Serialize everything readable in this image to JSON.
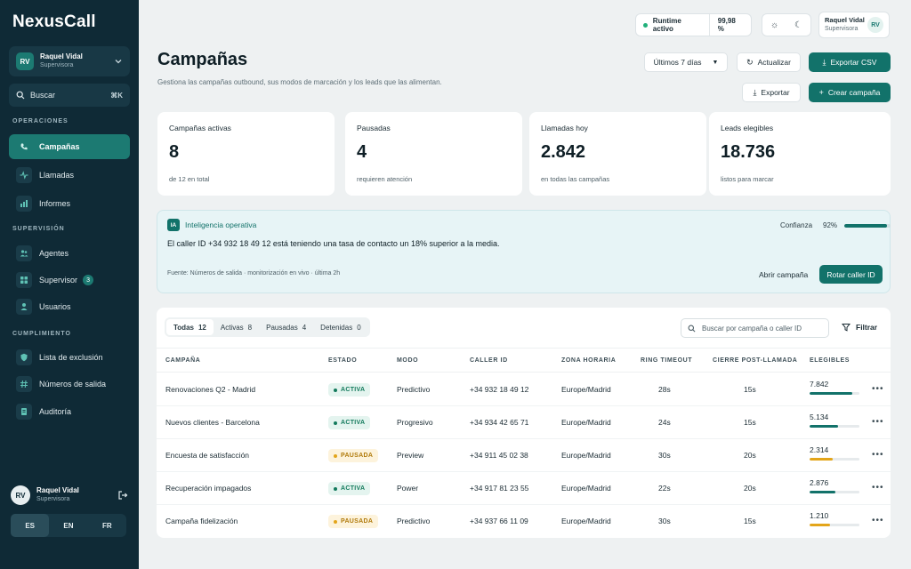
{
  "app": {
    "brand": "NexusCall"
  },
  "user": {
    "initials": "RV",
    "name": "Raquel Vidal",
    "role": "Supervisora"
  },
  "sidebar": {
    "search_label": "Buscar",
    "search_shortcut": "⌘K",
    "sections": {
      "operaciones": "OPERACIONES",
      "supervision": "SUPERVISIÓN",
      "cumplimiento": "CUMPLIMIENTO"
    },
    "items": [
      {
        "label": "Campañas",
        "icon": "phone-icon"
      },
      {
        "label": "Llamadas",
        "icon": "pulse-icon"
      },
      {
        "label": "Informes",
        "icon": "bar-chart-icon"
      },
      {
        "label": "Agentes",
        "icon": "users-icon"
      },
      {
        "label": "Supervisor",
        "icon": "grid-icon",
        "badge": "3"
      },
      {
        "label": "Usuarios",
        "icon": "user-icon"
      },
      {
        "label": "Lista de exclusión",
        "icon": "shield-icon"
      },
      {
        "label": "Números de salida",
        "icon": "hash-icon"
      },
      {
        "label": "Auditoría",
        "icon": "document-icon"
      }
    ],
    "languages": [
      "ES",
      "EN",
      "FR"
    ],
    "active_language": "ES"
  },
  "topbar": {
    "runtime_label": "Runtime activo",
    "runtime_value": "99,98 %"
  },
  "page": {
    "title": "Campañas",
    "subtitle": "Gestiona las campañas outbound, sus modos de marcación y los leads que las alimentan.",
    "range_select": "Últimos 7 días",
    "refresh": "Actualizar",
    "export_csv": "Exportar CSV",
    "export": "Exportar",
    "create": "Crear campaña"
  },
  "kpis": [
    {
      "label": "Campañas activas",
      "value": "8",
      "sub": "de 12 en total"
    },
    {
      "label": "Pausadas",
      "value": "4",
      "sub": "requieren atención"
    },
    {
      "label": "Llamadas hoy",
      "value": "2.842",
      "sub": "en todas las campañas"
    },
    {
      "label": "Leads elegibles",
      "value": "18.736",
      "sub": "listos para marcar"
    }
  ],
  "insight": {
    "tag": "IA",
    "title": "Inteligencia operativa",
    "confidence_label": "Confianza",
    "confidence_value": "92%",
    "confidence_fraction": 0.92,
    "message": "El caller ID +34 932 18 49 12 está teniendo una tasa de contacto un 18% superior a la media.",
    "source": "Fuente: Números de salida · monitorización en vivo · última 2h",
    "open": "Abrir campaña",
    "rotate": "Rotar caller ID"
  },
  "table": {
    "tabs": [
      {
        "label": "Todas",
        "count": "12"
      },
      {
        "label": "Activas",
        "count": "8"
      },
      {
        "label": "Pausadas",
        "count": "4"
      },
      {
        "label": "Detenidas",
        "count": "0"
      }
    ],
    "search_placeholder": "Buscar por campaña o caller ID",
    "filter": "Filtrar",
    "headers": [
      "CAMPAÑA",
      "ESTADO",
      "MODO",
      "CALLER ID",
      "ZONA HORARIA",
      "RING TIMEOUT",
      "CIERRE POST-LLAMADA",
      "ELEGIBLES"
    ],
    "rows": [
      {
        "name": "Renovaciones Q2 - Madrid",
        "status": "ACTIVA",
        "mode": "Predictivo",
        "caller": "+34 932 18 49 12",
        "tz": "Europe/Madrid",
        "ring": "28s",
        "wrap": "15s",
        "eligible": "7.842",
        "fill": 0.85
      },
      {
        "name": "Nuevos clientes - Barcelona",
        "status": "ACTIVA",
        "mode": "Progresivo",
        "caller": "+34 934 42 65 71",
        "tz": "Europe/Madrid",
        "ring": "24s",
        "wrap": "15s",
        "eligible": "5.134",
        "fill": 0.57
      },
      {
        "name": "Encuesta de satisfacción",
        "status": "PAUSADA",
        "mode": "Preview",
        "caller": "+34 911 45 02 38",
        "tz": "Europe/Madrid",
        "ring": "30s",
        "wrap": "20s",
        "eligible": "2.314",
        "fill": 0.46
      },
      {
        "name": "Recuperación impagados",
        "status": "ACTIVA",
        "mode": "Power",
        "caller": "+34 917 81 23 55",
        "tz": "Europe/Madrid",
        "ring": "22s",
        "wrap": "20s",
        "eligible": "2.876",
        "fill": 0.52
      },
      {
        "name": "Campaña fidelización",
        "status": "PAUSADA",
        "mode": "Predictivo",
        "caller": "+34 937 66 11 09",
        "tz": "Europe/Madrid",
        "ring": "30s",
        "wrap": "15s",
        "eligible": "1.210",
        "fill": 0.41
      }
    ]
  },
  "colors": {
    "accent": "#12726a",
    "active": "#137a5c",
    "paused": "#e3a51a"
  }
}
